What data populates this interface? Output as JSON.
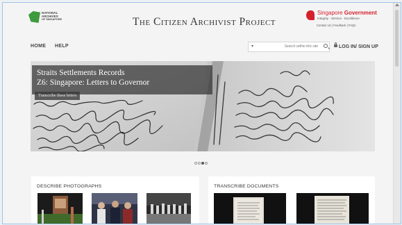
{
  "logo": {
    "lines": [
      "NATIONAL",
      "ARCHIVES",
      "OF SINGAPORE"
    ]
  },
  "site_title": "The Citizen Archivist Project",
  "gov": {
    "name_part1": "Singapore",
    "name_part2": "Government",
    "tagline": "Integrity · Service · Excellence",
    "links": "Contact Us  |  Feedback  |  FAQs"
  },
  "nav": {
    "home": "HOME",
    "help": "HELP",
    "login": "LOG IN/ SIGN UP"
  },
  "search": {
    "placeholder": "Search within this site",
    "dropdown": "▾"
  },
  "banner": {
    "title": "Straits Settlements Records",
    "subtitle": "Z6: Singapore: Letters to Governor",
    "cta": "Transcribe these letters",
    "slides": 4,
    "active_slide": 3
  },
  "panels": {
    "photos": {
      "title": "DESCRIBE PHOTOGRAPHS"
    },
    "documents": {
      "title": "TRANSCRIBE DOCUMENTS"
    }
  },
  "colors": {
    "accent_red": "#d61f2d",
    "logo_green": "#3f9a3d"
  }
}
